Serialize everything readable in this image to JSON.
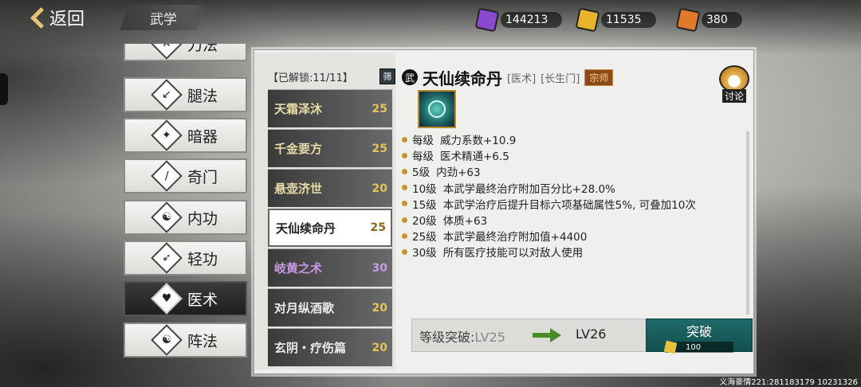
{
  "topbar": {
    "back_label": "返回",
    "tab_title": "武学",
    "currencies": [
      {
        "icon": "purple-ticket-icon",
        "color": "#8a4ad0",
        "value": "144213"
      },
      {
        "icon": "gold-ticket-icon",
        "color": "#e8b52a",
        "value": "11535"
      },
      {
        "icon": "orange-ticket-icon",
        "color": "#e07a2a",
        "value": "380"
      }
    ]
  },
  "categories": [
    {
      "label": "刀法",
      "icon": "blade-icon"
    },
    {
      "label": "腿法",
      "icon": "kick-icon"
    },
    {
      "label": "暗器",
      "icon": "shuriken-icon"
    },
    {
      "label": "奇门",
      "icon": "staff-icon"
    },
    {
      "label": "内功",
      "icon": "inner-power-icon"
    },
    {
      "label": "轻功",
      "icon": "lightness-icon"
    },
    {
      "label": "医术",
      "icon": "heart-icon",
      "active": true
    },
    {
      "label": "阵法",
      "icon": "taiji-icon"
    }
  ],
  "skill_list": {
    "unlock_text": "【已解锁:11/11】",
    "filter_label": "筛",
    "items": [
      {
        "name": "天霜泽沐",
        "level": "25"
      },
      {
        "name": "千金要方",
        "level": "25"
      },
      {
        "name": "悬壶济世",
        "level": "20"
      },
      {
        "name": "天仙续命丹",
        "level": "25",
        "active": true
      },
      {
        "name": "岐黄之术",
        "level": "30"
      },
      {
        "name": "对月纵酒歌",
        "level": "20"
      },
      {
        "name": "玄阴・疗伤篇",
        "level": "20"
      }
    ]
  },
  "detail": {
    "name": "天仙续命丹",
    "tag1": "[医术]",
    "tag2": "[长生门]",
    "rank": "宗师",
    "discuss_label": "讨论",
    "attributes": [
      {
        "lv": "每级",
        "text": "威力系数+10.9"
      },
      {
        "lv": "每级",
        "text": "医术精通+6.5"
      },
      {
        "lv": "5级",
        "text": "内劲+63"
      },
      {
        "lv": "10级",
        "text": "本武学最终治疗附加百分比+28.0%"
      },
      {
        "lv": "15级",
        "text": "本武学治疗后提升目标六项基础属性5%, 可叠加10次"
      },
      {
        "lv": "20级",
        "text": "体质+63"
      },
      {
        "lv": "25级",
        "text": "本武学最终治疗附加值+4400"
      },
      {
        "lv": "30级",
        "text": "所有医疗技能可以对敌人使用"
      }
    ]
  },
  "breakthrough": {
    "label": "等级突破:",
    "from": "LV25",
    "to": "LV26",
    "button_label": "突破",
    "cost": "100"
  },
  "footer": "义海豪情221:281183179 10231326"
}
